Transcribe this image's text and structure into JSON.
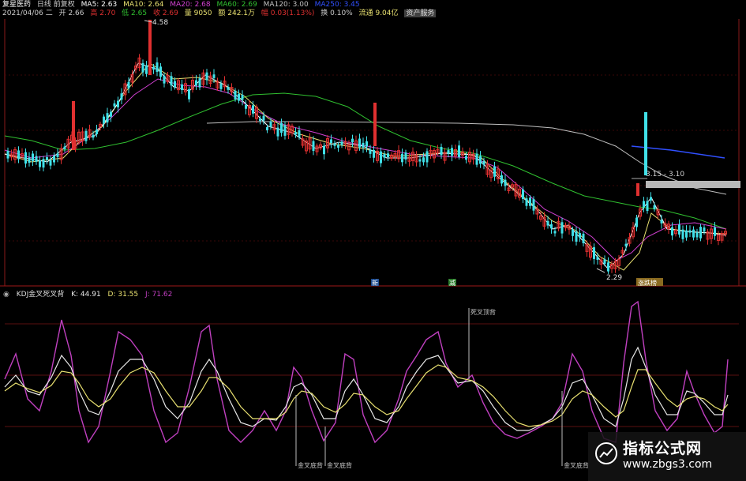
{
  "info_row1": {
    "name": "复星医药",
    "period": "日线 前复权",
    "ma5": "MA5: 2.63",
    "ma10": "MA10: 2.64",
    "ma20": "MA20: 2.68",
    "ma60": "MA60: 2.69",
    "ma120": "MA120: 3.00",
    "ma250": "MA250: 3.45"
  },
  "info_row2": {
    "date": "2021/04/06 二",
    "open": "开 2.66",
    "high": "高 2.70",
    "low": "低 2.65",
    "close": "收 2.69",
    "volume": "量 9050",
    "amount": "额 242.1万",
    "change": "幅 0.03(1.13%)",
    "turnover": "换 0.10%",
    "float": "流通 9.04亿",
    "button": "资产服务"
  },
  "price_annotations": {
    "high_label": "4.58",
    "low_label": "2.29",
    "range_label": "3.15 - 3.10",
    "marker_a": "新",
    "marker_b": "减",
    "marker_c": "涨跌榜"
  },
  "kdj": {
    "title": "KDJ金叉死叉背",
    "k": "K: 44.91",
    "d": "D: 31.55",
    "j": "J: 71.62",
    "signals": [
      "死叉顶背",
      "金叉底背",
      "金叉底背",
      "金叉底背"
    ]
  },
  "watermark": {
    "title": "指标公式网",
    "url": "www.zbgs3.com"
  },
  "colors": {
    "up": "#e03030",
    "down": "#40e0e8",
    "ma5": "#ffffff",
    "ma10": "#e8e070",
    "ma20": "#d040d0",
    "ma60": "#30c030",
    "ma120": "#c0c0c0",
    "ma250": "#3050ff",
    "k": "#e8e8e8",
    "d": "#e8e070",
    "j": "#c040c0"
  }
}
